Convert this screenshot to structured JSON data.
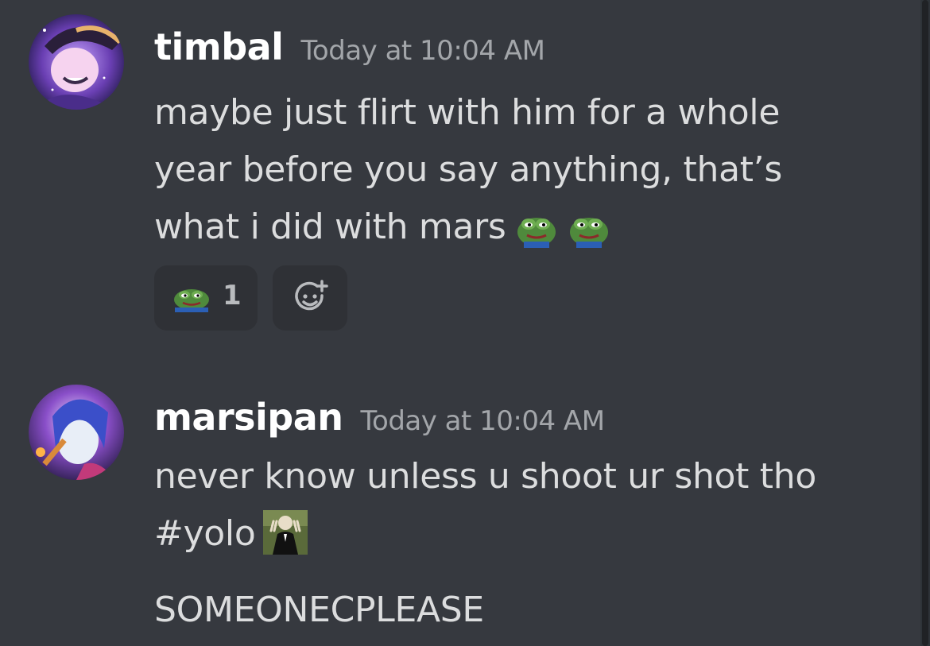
{
  "messages": [
    {
      "username": "timbal",
      "timestamp": "Today at 10:04 AM",
      "lines": [
        "maybe just flirt with him for a whole",
        "year before you say anything, that’s",
        "what i did with mars"
      ],
      "inline_emojis": [
        "pepe-hmm-emoji",
        "pepe-hmm-emoji"
      ],
      "reactions": [
        {
          "emoji": "pepe-emoji",
          "count": "1"
        }
      ]
    },
    {
      "username": "marsipan",
      "timestamp": "Today at 10:04 AM",
      "lines": [
        "never know unless u shoot ur shot tho",
        "#yolo",
        "SOMEONECPLEASE"
      ],
      "inline_emojis": [
        "peace-sign-man-emoji"
      ]
    }
  ],
  "colors": {
    "background": "#36393f",
    "username": "#ffffff",
    "timestamp": "#a3a6aa",
    "text": "#dcddde",
    "reaction_bg": "#2f3136"
  }
}
